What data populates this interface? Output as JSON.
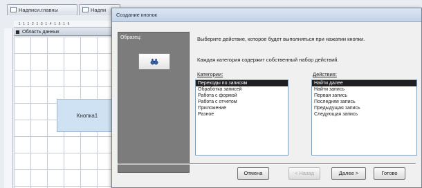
{
  "designer": {
    "tabs": [
      {
        "label": "Надписи.главны"
      },
      {
        "label": "Надпи"
      }
    ],
    "ruler_marks": "·1·1·1·2·1·3·1·4·1·5·1·6",
    "section_label": "Область данных",
    "form_button_label": "Кнопка1"
  },
  "dialog": {
    "title": "Создание кнопок",
    "sample_label": "Образец:",
    "sample_icon": "binoculars-icon",
    "instruction_1": "Выберите действие, которое будет выполняться при нажатии кнопки.",
    "instruction_2": "Каждая категория содержит собственный набор действий.",
    "categories_label": "Категории:",
    "actions_label": "Действия:",
    "categories": [
      {
        "label": "Переходы по записям",
        "selected": true
      },
      {
        "label": "Обработка записей",
        "selected": false
      },
      {
        "label": "Работа с формой",
        "selected": false
      },
      {
        "label": "Работа с отчетом",
        "selected": false
      },
      {
        "label": "Приложение",
        "selected": false
      },
      {
        "label": "Разное",
        "selected": false
      }
    ],
    "actions": [
      {
        "label": "Найти далее",
        "selected": true
      },
      {
        "label": "Найти запись",
        "selected": false
      },
      {
        "label": "Первая запись",
        "selected": false
      },
      {
        "label": "Последняя запись",
        "selected": false
      },
      {
        "label": "Предыдущая запись",
        "selected": false
      },
      {
        "label": "Следующая запись",
        "selected": false
      }
    ],
    "buttons": {
      "cancel": "Отмена",
      "back": "< Назад",
      "next": "Далее >",
      "finish": "Готово"
    }
  }
}
